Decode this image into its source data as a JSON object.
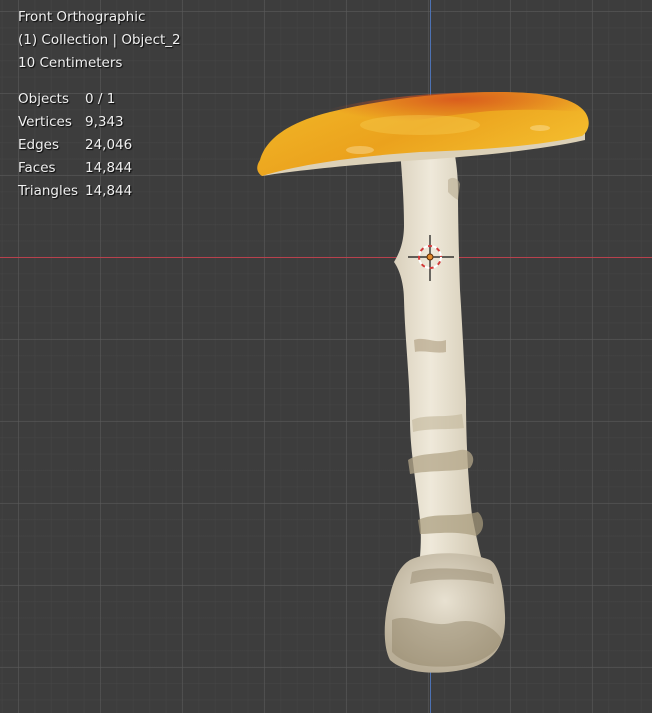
{
  "viewport": {
    "view_name": "Front Orthographic",
    "collection_info": "(1) Collection | Object_2",
    "grid_scale": "10 Centimeters"
  },
  "stats": [
    {
      "label": "Objects",
      "value": "0 / 1"
    },
    {
      "label": "Vertices",
      "value": "9,343"
    },
    {
      "label": "Edges",
      "value": "24,046"
    },
    {
      "label": "Faces",
      "value": "14,844"
    },
    {
      "label": "Triangles",
      "value": "14,844"
    }
  ],
  "colors": {
    "background": "#3d3d3d",
    "x_axis": "#b8414d",
    "z_axis": "#4d72b3",
    "cap_top": "#e9a61a",
    "stem": "#e4dccb"
  }
}
